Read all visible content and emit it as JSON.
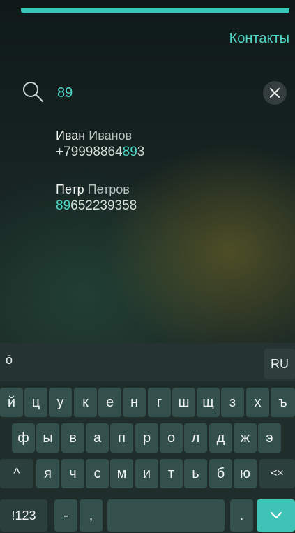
{
  "header": {
    "title": "Контакты"
  },
  "search": {
    "query": "89"
  },
  "results": [
    {
      "first_name": "Иван",
      "last_name": "Иванов",
      "phone_prefix": "+79998864",
      "phone_match": "89",
      "phone_suffix": "3"
    },
    {
      "first_name": "Петр",
      "last_name": "Петров",
      "phone_prefix": "",
      "phone_match": "89",
      "phone_suffix": "652239358"
    }
  ],
  "keyboard": {
    "mode_label": "ō",
    "language": "RU",
    "row1": [
      "й",
      "ц",
      "у",
      "к",
      "е",
      "н",
      "г",
      "ш",
      "щ",
      "з",
      "х",
      "ъ"
    ],
    "row2": [
      "ф",
      "ы",
      "в",
      "а",
      "п",
      "р",
      "о",
      "л",
      "д",
      "ж",
      "э"
    ],
    "row3": [
      "я",
      "ч",
      "с",
      "м",
      "и",
      "т",
      "ь",
      "б",
      "ю"
    ],
    "shift_label": "^",
    "backspace_label": "<×",
    "symbols_label": "!123",
    "dash_label": "-",
    "comma_label": ",",
    "period_label": ".",
    "enter_label": "✓"
  },
  "colors": {
    "accent": "#4fd6c9",
    "background": "#172422",
    "key": "#34504c"
  }
}
